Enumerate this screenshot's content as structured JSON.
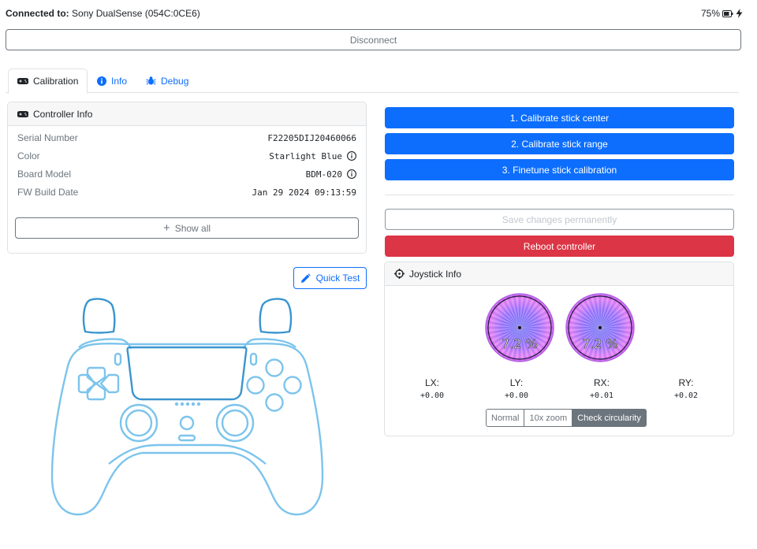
{
  "status": {
    "connected_label": "Connected to:",
    "device": "Sony DualSense (054C:0CE6)",
    "battery": "75%"
  },
  "disconnect_label": "Disconnect",
  "tabs": [
    {
      "label": "Calibration",
      "icon": "gamepad-icon",
      "active": true
    },
    {
      "label": "Info",
      "icon": "info-circle-icon",
      "active": false
    },
    {
      "label": "Debug",
      "icon": "bug-icon",
      "active": false
    }
  ],
  "controller_info": {
    "title": "Controller Info",
    "rows": [
      {
        "key": "Serial Number",
        "value": "F22205DIJ20460066",
        "info": false
      },
      {
        "key": "Color",
        "value": "Starlight Blue",
        "info": true
      },
      {
        "key": "Board Model",
        "value": "BDM-020",
        "info": true
      },
      {
        "key": "FW Build Date",
        "value": "Jan 29 2024 09:13:59",
        "info": false
      }
    ],
    "show_all": "Show all"
  },
  "quick_test": "Quick Test",
  "actions": {
    "calib_center": "1. Calibrate stick center",
    "calib_range": "2. Calibrate stick range",
    "finetune": "3. Finetune stick calibration",
    "save": "Save changes permanently",
    "reboot": "Reboot controller"
  },
  "joystick": {
    "title": "Joystick Info",
    "left_pct": "7.2 %",
    "right_pct": "7.2 %",
    "axes": [
      {
        "label": "LX:",
        "value": "+0.00"
      },
      {
        "label": "LY:",
        "value": "+0.00"
      },
      {
        "label": "RX:",
        "value": "+0.01"
      },
      {
        "label": "RY:",
        "value": "+0.02"
      }
    ],
    "modes": [
      "Normal",
      "10x zoom",
      "Check circularity"
    ],
    "selected_mode": "Check circularity"
  },
  "colors": {
    "primary": "#0d6efd",
    "danger": "#dc3545",
    "secondary": "#6c757d",
    "outline_controller": "#7cc4ec",
    "outline_controller_dark": "#2f7fb3"
  }
}
